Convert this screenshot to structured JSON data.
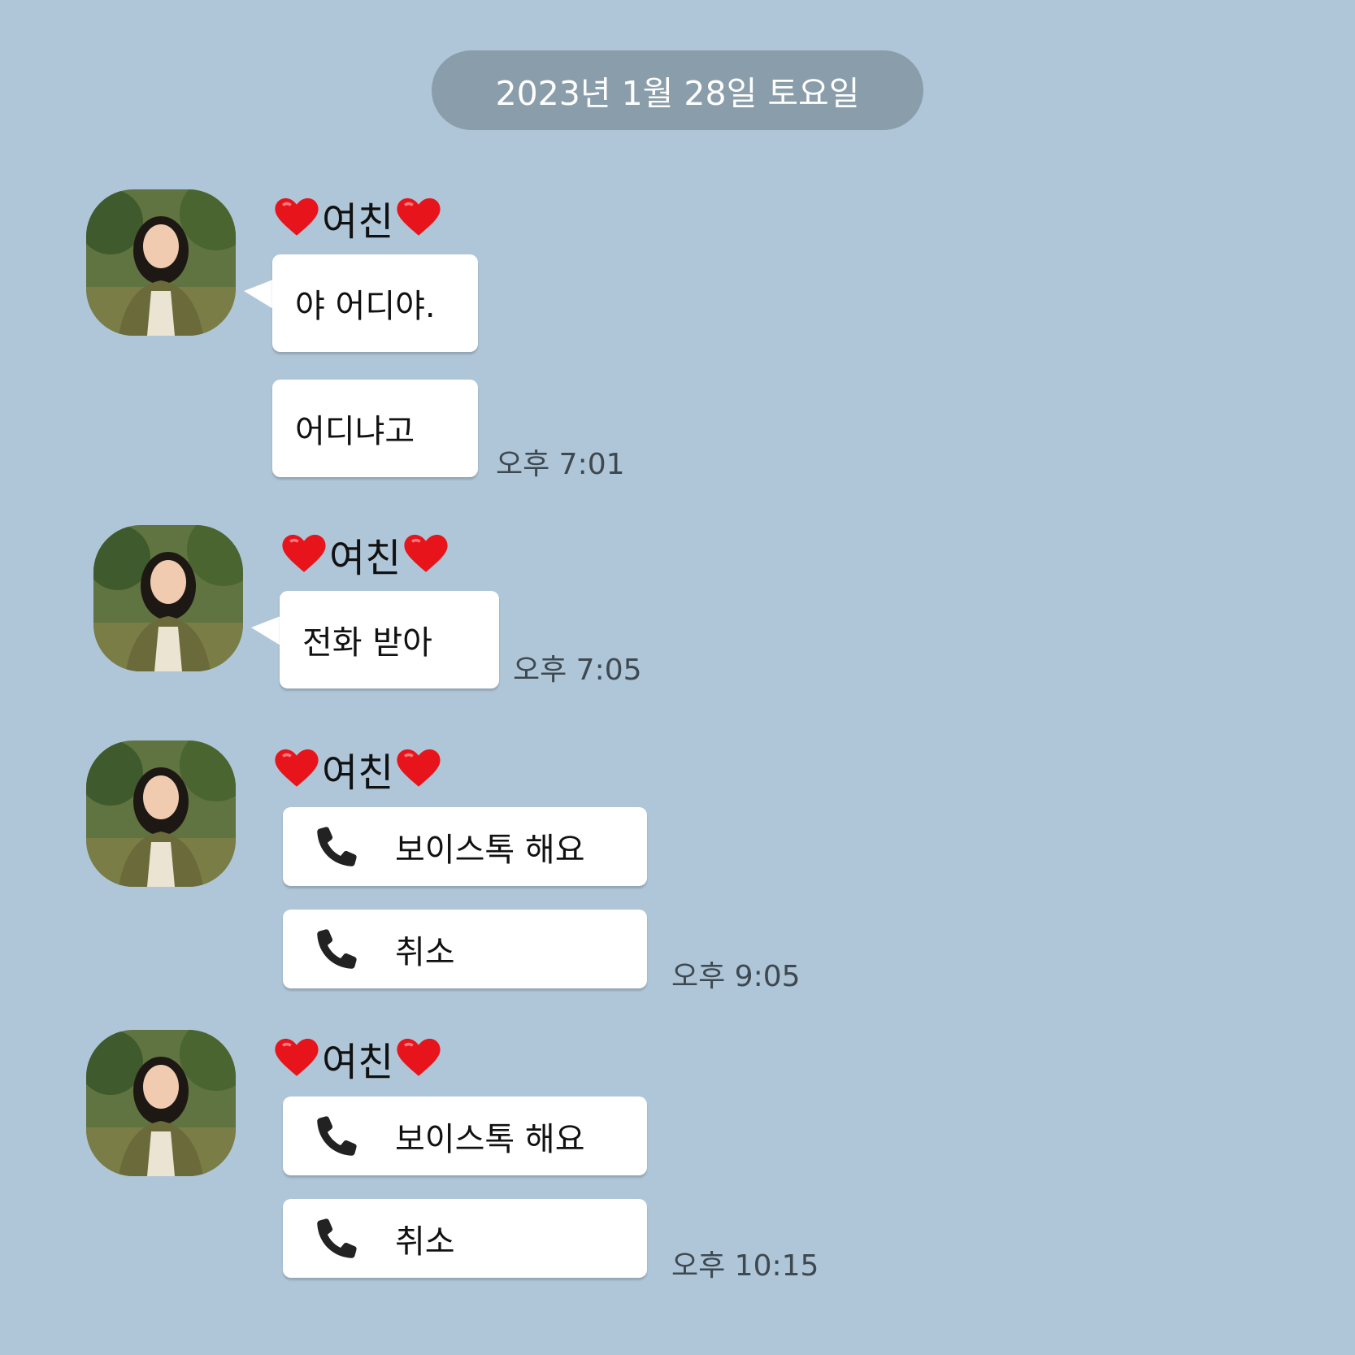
{
  "date_divider": "2023년 1월 28일 토요일",
  "sender_name": "여친",
  "icons": {
    "avatar": "profile-photo-icon",
    "heart": "red-heart-icon",
    "phone": "phone-icon"
  },
  "colors": {
    "background": "#afc6d8",
    "date_pill": "#8a9daa",
    "bubble": "#ffffff",
    "heart": "#e8141b"
  },
  "groups": [
    {
      "messages": [
        "야 어디야.",
        "어디냐고"
      ],
      "time": "오후 7:01"
    },
    {
      "messages": [
        "전화 받아"
      ],
      "time": "오후 7:05"
    },
    {
      "calls": [
        "보이스톡 해요",
        "취소"
      ],
      "time": "오후 9:05"
    },
    {
      "calls": [
        "보이스톡 해요",
        "취소"
      ],
      "time": "오후 10:15"
    }
  ]
}
